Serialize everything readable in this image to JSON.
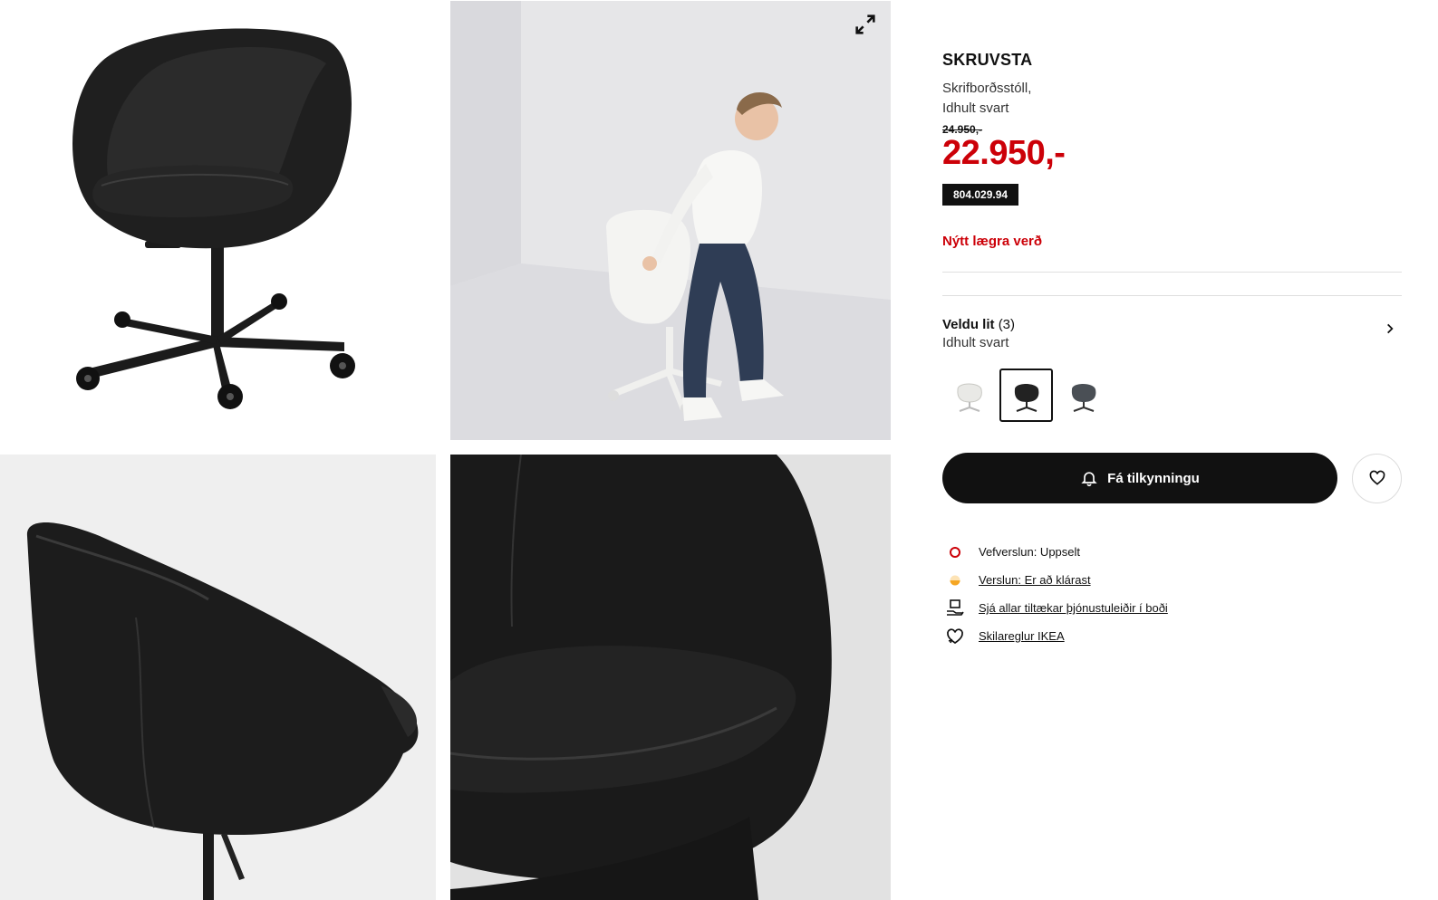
{
  "gallery": {
    "images": [
      {
        "name": "product-front-image",
        "icon": "black-swivel-chair-front"
      },
      {
        "name": "product-lifestyle-image",
        "icon": "man-sitting-on-white-chair"
      },
      {
        "name": "product-side-image",
        "icon": "black-chair-side-view"
      },
      {
        "name": "product-detail-image",
        "icon": "black-chair-seat-closeup"
      }
    ],
    "expand_icon": "expand-arrows-icon"
  },
  "product": {
    "name": "SKRUVSTA",
    "description_line1": "Skrifborðsstóll,",
    "description_line2": "Idhult svart",
    "old_price": "24.950,-",
    "price": "22.950,-",
    "article_number": "804.029.94",
    "new_lower_price": "Nýtt lægra verð"
  },
  "color": {
    "label": "Veldu lit",
    "count": "(3)",
    "selected": "Idhult svart",
    "swatches": [
      {
        "name": "white",
        "color": "#e8e8e4",
        "selected": false
      },
      {
        "name": "black",
        "color": "#222222",
        "selected": true
      },
      {
        "name": "dark-grey",
        "color": "#4a4f55",
        "selected": false
      }
    ]
  },
  "actions": {
    "notify_label": "Fá tilkynningu",
    "favorite_icon": "heart-icon"
  },
  "availability": {
    "online": "Vefverslun: Uppselt",
    "store": "Verslun: Er að klárast",
    "services": "Sjá allar tiltækar þjónustuleiðir í boði",
    "returns": "Skilareglur IKEA"
  },
  "colors": {
    "sale_red": "#cc0008",
    "status_out_of_stock": "#cc0008",
    "status_low_stock": "#f5a623",
    "button_black": "#111111"
  }
}
